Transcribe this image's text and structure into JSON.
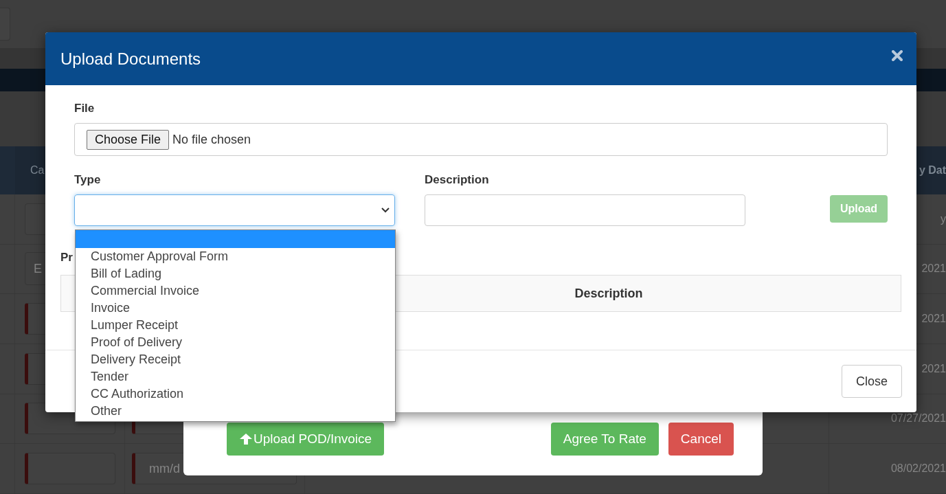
{
  "background": {
    "header_cells": [
      {
        "label": "Ca",
        "kind": "left"
      },
      {
        "label": "y Dat",
        "kind": "right"
      }
    ],
    "rows": [
      {
        "kind": "plain",
        "date": "y"
      },
      {
        "kind": "button",
        "button": "E",
        "date": "2021"
      },
      {
        "kind": "flagged",
        "date": "2021"
      },
      {
        "kind": "flagged",
        "date": "2021"
      },
      {
        "kind": "flagged_date",
        "date": "07/27/2021"
      },
      {
        "kind": "flagged_date",
        "placeholder": "mm/d",
        "date": "08/02/2021"
      }
    ]
  },
  "rate_dialog": {
    "buttons": [
      {
        "label": "Upload POD/Invoice",
        "kind": "upload"
      },
      {
        "label": "Agree To Rate",
        "kind": "success"
      },
      {
        "label": "Cancel",
        "kind": "danger"
      }
    ]
  },
  "dialog": {
    "title": "Upload Documents",
    "file_label": "File",
    "choose_button": "Choose File",
    "file_status": "No file chosen",
    "type_label": "Type",
    "description_label": "Description",
    "upload_button": {
      "label": "Upload",
      "disabled": true
    },
    "section_label": "Pr",
    "table_columns": [
      "Description"
    ],
    "close_button": "Close"
  },
  "type_dropdown": {
    "expanded": true,
    "blank_option": {
      "selected": true
    },
    "options": [
      {
        "label": "Customer Approval Form",
        "selected": false
      },
      {
        "label": "Bill of Lading",
        "selected": false
      },
      {
        "label": "Commercial Invoice",
        "selected": false
      },
      {
        "label": "Invoice",
        "selected": false
      },
      {
        "label": "Lumper Receipt",
        "selected": false
      },
      {
        "label": "Proof of Delivery",
        "selected": false
      },
      {
        "label": "Delivery Receipt",
        "selected": false
      },
      {
        "label": "Tender",
        "selected": false
      },
      {
        "label": "CC Authorization",
        "selected": false
      },
      {
        "label": "Other",
        "selected": false
      }
    ]
  }
}
